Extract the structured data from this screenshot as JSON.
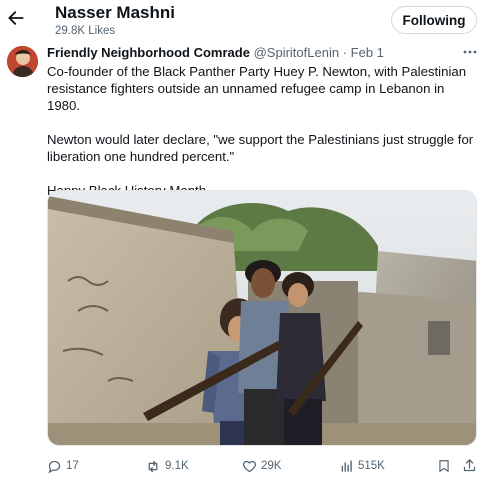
{
  "header": {
    "back_icon": "arrow-left-icon",
    "profile_name": "Nasser Mashni",
    "likes_text": "29.8K Likes",
    "follow_label": "Following"
  },
  "tweet": {
    "author_name": "Friendly Neighborhood Comrade",
    "handle": "@SpiritofLenin",
    "separator": "·",
    "date": "Feb 1",
    "paragraphs": [
      "Co-founder of the Black Panther Party Huey P. Newton, with Palestinian resistance fighters outside an unnamed refugee camp in Lebanon in 1980.",
      "Newton would later declare, \"we support the Palestinians just struggle for liberation one hundred percent.\"",
      "Happy Black History Month."
    ]
  },
  "actions": {
    "replies": "17",
    "reposts": "9.1K",
    "likes": "29K",
    "views": "515K"
  },
  "colors": {
    "text": "#0f1419",
    "muted": "#536471",
    "border": "#cfd9de"
  }
}
